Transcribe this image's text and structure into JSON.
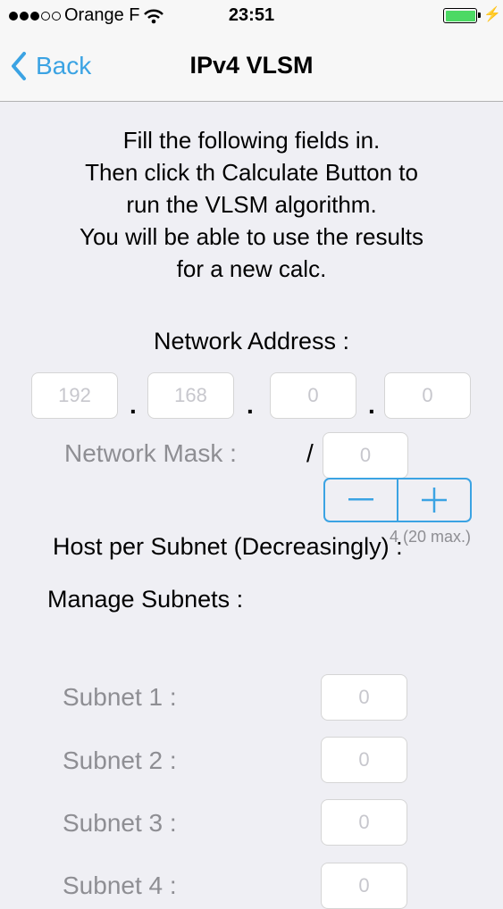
{
  "status": {
    "carrier": "Orange F",
    "time": "23:51"
  },
  "nav": {
    "back_label": "Back",
    "title": "IPv4 VLSM"
  },
  "instructions": [
    "Fill the following fields in.",
    "Then click th Calculate Button to",
    "run the VLSM algorithm.",
    "You will be able to use the results",
    "for a new calc."
  ],
  "network_address": {
    "label": "Network Address :",
    "octets": [
      "192",
      "168",
      "0",
      "0"
    ],
    "separator": "."
  },
  "network_mask": {
    "label": "Network Mask :",
    "slash": "/",
    "placeholder": "0"
  },
  "hosts_label": "Host per Subnet (Decreasingly) :",
  "manage": {
    "label": "Manage Subnets :",
    "count_text": "4 (20 max.)"
  },
  "subnets": [
    {
      "label": "Subnet 1 :",
      "placeholder": "0"
    },
    {
      "label": "Subnet 2 :",
      "placeholder": "0"
    },
    {
      "label": "Subnet 3 :",
      "placeholder": "0"
    },
    {
      "label": "Subnet 4 :",
      "placeholder": "0"
    }
  ],
  "colors": {
    "accent": "#3ba3e3",
    "battery": "#4cd964",
    "background": "#efeff4"
  }
}
